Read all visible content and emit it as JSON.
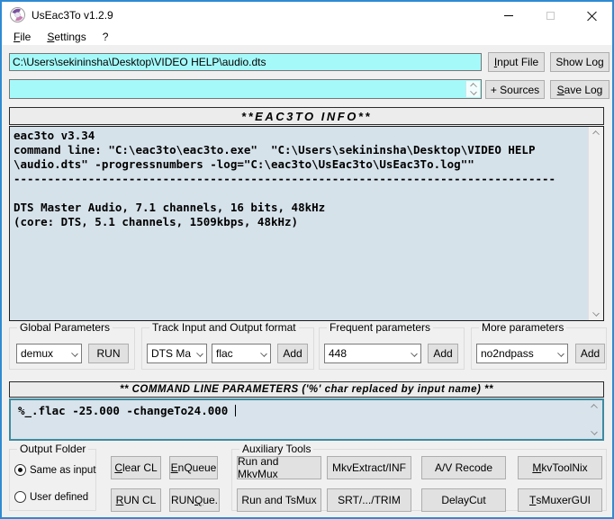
{
  "window": {
    "title": "UsEac3To v1.2.9"
  },
  "menu": {
    "file": "&File",
    "settings": "&Settings",
    "help": "?"
  },
  "file_input": {
    "value": "C:\\Users\\sekininsha\\Desktop\\VIDEO HELP\\audio.dts"
  },
  "sources_input": {
    "value": ""
  },
  "top_buttons": {
    "input_file": "&Input File",
    "show_log": "Show Log",
    "add_sources": "+ Sources",
    "save_log": "&Save Log"
  },
  "info_panel": {
    "header": "**EAC3TO INFO**",
    "content": "eac3to v3.34\ncommand line: \"C:\\eac3to\\eac3to.exe\"  \"C:\\Users\\sekininsha\\Desktop\\VIDEO HELP\n\\audio.dts\" -progressnumbers -log=\"C:\\eac3to\\UsEac3to\\UsEac3To.log\"\"\n--------------------------------------------------------------------------------\n\nDTS Master Audio, 7.1 channels, 16 bits, 48kHz\n(core: DTS, 5.1 channels, 1509kbps, 48kHz)"
  },
  "groups": {
    "global": {
      "title": "Global Parameters",
      "dropdown_value": "demux",
      "run_label": "RUN"
    },
    "track": {
      "title": "Track Input and Output format",
      "input_format": "DTS Ma",
      "output_format": "flac",
      "add_label": "Add"
    },
    "frequent": {
      "title": "Frequent parameters",
      "dropdown_value": "448",
      "add_label": "Add"
    },
    "more": {
      "title": "More parameters",
      "dropdown_value": "no2ndpass",
      "add_label": "Add"
    }
  },
  "command_panel": {
    "header": "** COMMAND LINE PARAMETERS ('%' char replaced by input name) **",
    "content": "%_.flac -25.000 -changeTo24.000 "
  },
  "output_folder": {
    "title": "Output Folder",
    "option_same": "Same as input",
    "option_user": "User defined",
    "selected": "Same as input"
  },
  "action_buttons": {
    "clear_cl": "&Clear CL",
    "enqueue": "&EnQueue",
    "run_cl": "&RUN CL",
    "run_que": "RUN &Que."
  },
  "aux_tools": {
    "title": "Auxiliary Tools",
    "buttons": [
      "Run and MkvMux",
      "MkvExtract/INF",
      "A/V Recode",
      "&MkvToolNix",
      "Run and TsMux",
      "SRT/.../TRIM",
      "DelayCut",
      "&TsMuxerGUI"
    ]
  },
  "colors": {
    "window_border": "#2f8ad2",
    "input_cyan": "#a6f9f9",
    "info_background": "#d6e2ea",
    "command_border": "#3e8ba0",
    "titlebar": "#ffffff",
    "client_background": "#f0f0f0"
  }
}
